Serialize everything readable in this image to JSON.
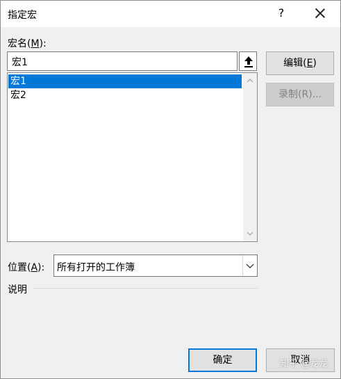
{
  "window": {
    "title": "指定宏",
    "help": "?",
    "close_icon": "close-icon"
  },
  "macro_name": {
    "label_pre": "宏名(",
    "label_key": "M",
    "label_post": "):",
    "value": "宏1"
  },
  "macro_list": {
    "items": [
      "宏1",
      "宏2"
    ],
    "selected_index": 0
  },
  "buttons": {
    "edit_pre": "编辑(",
    "edit_key": "E",
    "edit_post": ")",
    "record": "录制(R)...",
    "ok": "确定",
    "cancel": "取消"
  },
  "location": {
    "label_pre": "位置(",
    "label_key": "A",
    "label_post": "):",
    "value": "所有打开的工作簿"
  },
  "description": {
    "label": "说明"
  },
  "watermark": "知乎 @龙龙",
  "colors": {
    "selection": "#0078d7",
    "default_button_border": "#0078d7",
    "dialog_bg": "#f0f0f0"
  }
}
